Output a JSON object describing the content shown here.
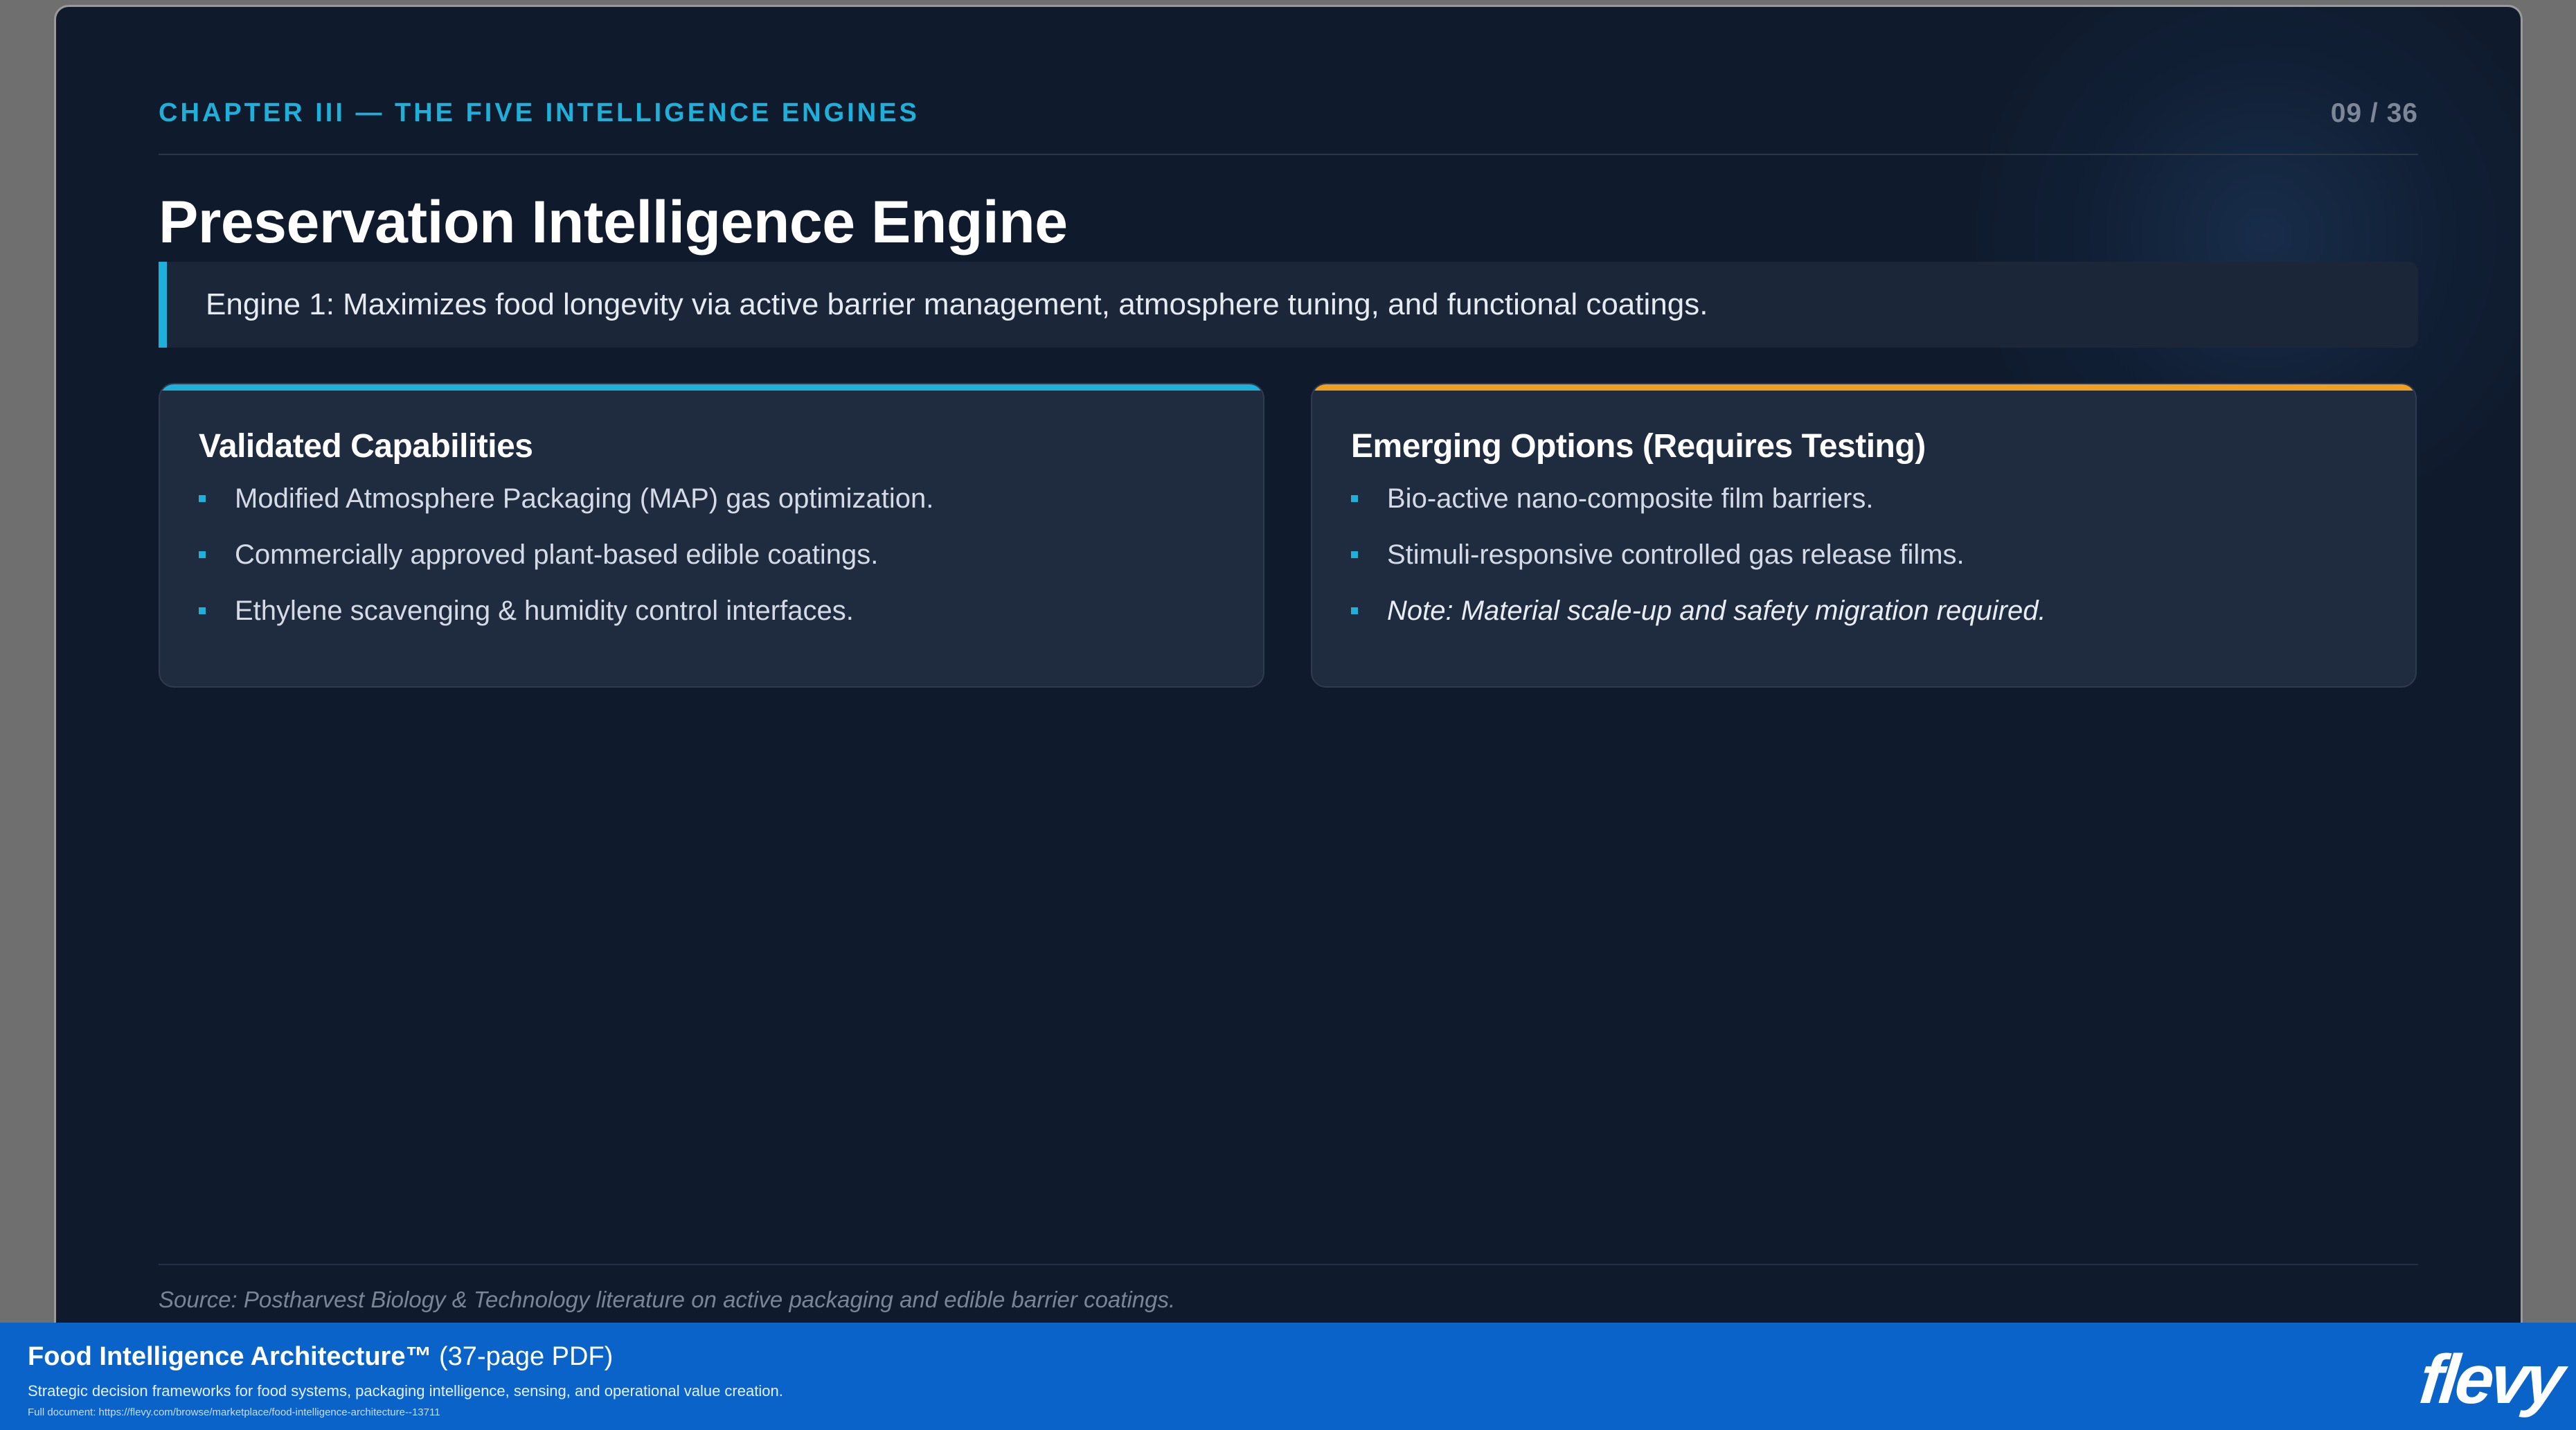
{
  "slide": {
    "chapter": "CHAPTER III — THE FIVE INTELLIGENCE ENGINES",
    "page": "09 / 36",
    "title": "Preservation Intelligence Engine",
    "callout": "Engine 1: Maximizes food longevity via active barrier management, atmosphere tuning, and functional coatings.",
    "cards": [
      {
        "heading": "Validated Capabilities",
        "accent": "#1fb0d9",
        "items": [
          "Modified Atmosphere Packaging (MAP) gas optimization.",
          "Commercially approved plant-based edible coatings.",
          "Ethylene scavenging & humidity control interfaces."
        ]
      },
      {
        "heading": "Emerging Options (Requires Testing)",
        "accent": "#f0a020",
        "items": [
          "Bio-active nano-composite film barriers.",
          "Stimuli-responsive controlled gas release films.",
          "Note: Material scale-up and safety migration required."
        ]
      }
    ],
    "source": "Source: Postharvest Biology & Technology literature on active packaging and edible barrier coatings."
  },
  "banner": {
    "title": "Food Intelligence Architecture™",
    "title_suffix": "(37-page PDF)",
    "description": "Strategic decision frameworks for food systems, packaging intelligence, sensing, and operational value creation.",
    "url": "Full document: https://flevy.com/browse/marketplace/food-intelligence-architecture--13711",
    "logo": "flevy"
  },
  "colors": {
    "background": "#0f1a2c",
    "accent_cyan": "#1fb0d9",
    "accent_orange": "#f0a020",
    "banner": "#0a63c9"
  }
}
